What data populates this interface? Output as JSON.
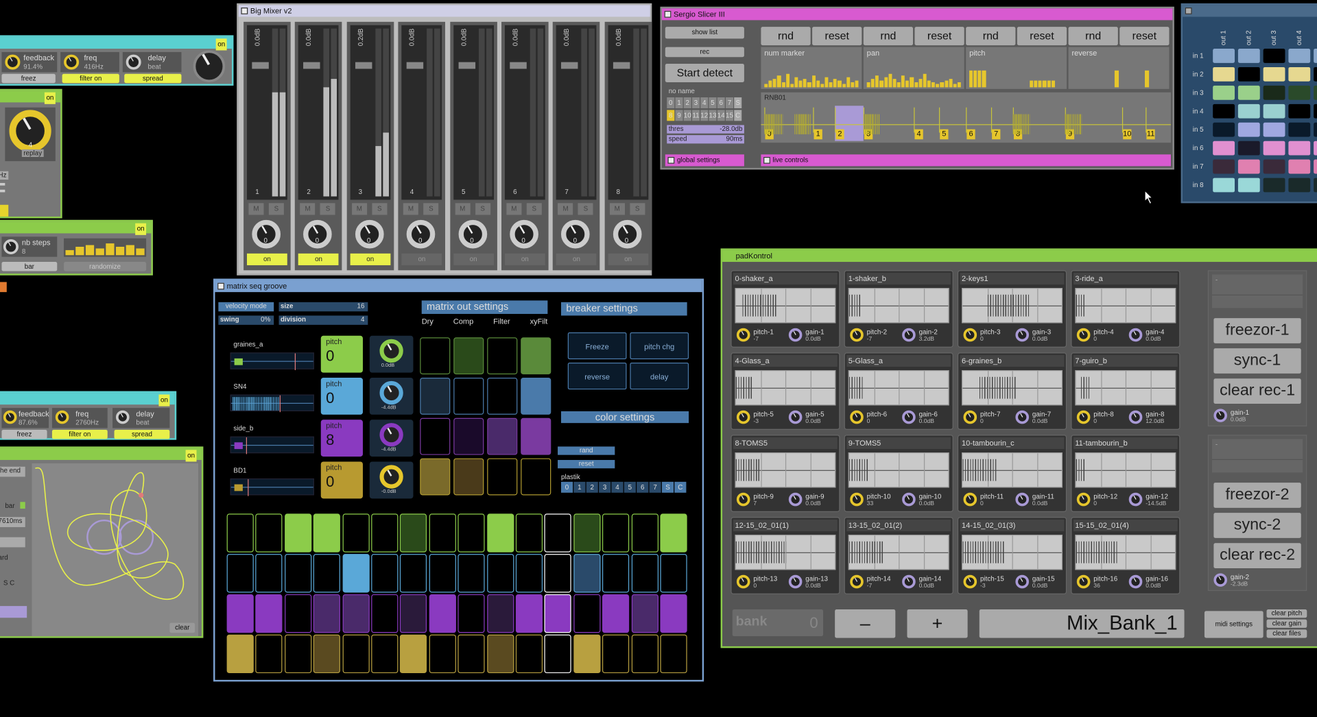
{
  "colors": {
    "bg": "#000000",
    "yellow": "#e8f04a",
    "green": "#8ccc4a",
    "pink": "#d85ad0",
    "purple": "#7a3aa0",
    "olive": "#b09a30",
    "blue": "#2a4a6a"
  },
  "delay1": {
    "on": "on",
    "feedback_label": "feedback",
    "feedback_value": "91.4%",
    "freq_label": "freq",
    "freq_value": "416Hz",
    "delay_label": "delay",
    "delay_value": "beat",
    "knob_value": "0",
    "freez": "freez",
    "filter": "filter on",
    "spread": "spread"
  },
  "replay": {
    "on": "on",
    "label": "replay",
    "value": "4",
    "hz": "Hz"
  },
  "steps": {
    "on": "on",
    "label": "nb steps",
    "value": "8",
    "bar": "bar",
    "randomize": "randomize"
  },
  "delay2": {
    "on": "on",
    "feedback_label": "feedback",
    "feedback_value": "87.6%",
    "freq_label": "freq",
    "freq_value": "2760Hz",
    "delay_label": "delay",
    "delay_value": "beat",
    "freez": "freez",
    "filter": "filter on",
    "spread": "spread"
  },
  "path": {
    "on": "on",
    "the_end": "he end",
    "bar": "bar",
    "ms": "7610ms",
    "ard": "ard",
    "sc": "S C",
    "clear": "clear"
  },
  "mixer": {
    "title": "Big Mixer v2",
    "channels": [
      {
        "db": "0.0dB",
        "num": "1",
        "val": "0",
        "on": "on"
      },
      {
        "db": "0.0dB",
        "num": "2",
        "val": "0",
        "on": "on"
      },
      {
        "db": "0.2dB",
        "num": "3",
        "val": "0",
        "on": "on"
      },
      {
        "db": "0.0dB",
        "num": "4",
        "val": "0",
        "on": "on"
      },
      {
        "db": "0.0dB",
        "num": "5",
        "val": "0",
        "on": "on"
      },
      {
        "db": "0.0dB",
        "num": "6",
        "val": "0",
        "on": "on"
      },
      {
        "db": "0.0dB",
        "num": "7",
        "val": "0",
        "on": "on"
      },
      {
        "db": "0.0dB",
        "num": "8",
        "val": "0",
        "on": "on"
      }
    ],
    "m": "M",
    "s": "S"
  },
  "slicer": {
    "title": "Sergio Slicer III",
    "show_list": "show list",
    "rec": "rec",
    "start_detect": "Start detect",
    "top_buttons": [
      "rnd",
      "reset",
      "rnd",
      "reset",
      "rnd",
      "reset",
      "rnd",
      "reset"
    ],
    "lanes": [
      "num marker",
      "pan",
      "pitch",
      "reverse"
    ],
    "no_name": "no name",
    "row1": [
      "0",
      "1",
      "2",
      "3",
      "4",
      "5",
      "6",
      "7",
      "S"
    ],
    "row2": [
      "8",
      "9",
      "10",
      "11",
      "12",
      "13",
      "14",
      "15",
      "C"
    ],
    "thres_label": "thres",
    "thres_value": "-28.0db",
    "speed_label": "speed",
    "speed_value": "90ms",
    "sample": "RNB01",
    "markers": [
      "0",
      "1",
      "2",
      "3",
      "4",
      "5",
      "6",
      "7",
      "8",
      "9",
      "10",
      "11"
    ],
    "global": "global settings",
    "live": "live controls"
  },
  "routing": {
    "cols": [
      "out 1",
      "out 2",
      "out 3",
      "out 4"
    ],
    "rows": [
      "in 1",
      "in 2",
      "in 3",
      "in 4",
      "in 5",
      "in 6",
      "in 7",
      "in 8"
    ]
  },
  "matrix": {
    "title": "matrix seq groove",
    "velocity_mode": "velocity mode",
    "size_label": "size",
    "size_value": "16",
    "swing_label": "swing",
    "swing_value": "0%",
    "division_label": "division",
    "division_value": "4",
    "tracks": [
      {
        "name": "graines_a",
        "pitch": "0",
        "db": "0.0dB"
      },
      {
        "name": "SN4",
        "pitch": "0",
        "db": "-4.4dB"
      },
      {
        "name": "side_b",
        "pitch": "8",
        "db": "-4.4dB"
      },
      {
        "name": "BD1",
        "pitch": "0",
        "db": "-0.0dB"
      }
    ],
    "pitch_label": "pitch",
    "out_settings": "matrix out settings",
    "out_tabs": [
      "Dry",
      "Comp",
      "Filter",
      "xyFilt"
    ],
    "breaker": "breaker settings",
    "breaker_buttons": [
      "Freeze",
      "pitch chg",
      "reverse",
      "delay"
    ],
    "color_settings": "color settings",
    "rand": "rand",
    "reset": "reset",
    "plastik": "plastik",
    "plastik_row": [
      "0",
      "1",
      "2",
      "3",
      "4",
      "5",
      "6",
      "7",
      "S",
      "C"
    ]
  },
  "pad": {
    "title": "padKontrol",
    "pads": [
      {
        "name": "0-shaker_a",
        "p": "pitch-1",
        "pv": "-7",
        "g": "gain-1",
        "gv": "0.0dB"
      },
      {
        "name": "1-shaker_b",
        "p": "pitch-2",
        "pv": "-7",
        "g": "gain-2",
        "gv": "3.2dB"
      },
      {
        "name": "2-keys1",
        "p": "pitch-3",
        "pv": "0",
        "g": "gain-3",
        "gv": "0.0dB"
      },
      {
        "name": "3-ride_a",
        "p": "pitch-4",
        "pv": "0",
        "g": "gain-4",
        "gv": "0.0dB"
      },
      {
        "name": "4-Glass_a",
        "p": "pitch-5",
        "pv": "-3",
        "g": "gain-5",
        "gv": "0.0dB"
      },
      {
        "name": "5-Glass_a",
        "p": "pitch-6",
        "pv": "0",
        "g": "gain-6",
        "gv": "0.0dB"
      },
      {
        "name": "6-graines_b",
        "p": "pitch-7",
        "pv": "0",
        "g": "gain-7",
        "gv": "0.0dB"
      },
      {
        "name": "7-guiro_b",
        "p": "pitch-8",
        "pv": "0",
        "g": "gain-8",
        "gv": "12.0dB"
      },
      {
        "name": "8-TOMS5",
        "p": "pitch-9",
        "pv": "7",
        "g": "gain-9",
        "gv": "0.0dB"
      },
      {
        "name": "9-TOMS5",
        "p": "pitch-10",
        "pv": "33",
        "g": "gain-10",
        "gv": "0.0dB"
      },
      {
        "name": "10-tambourin_c",
        "p": "pitch-11",
        "pv": "0",
        "g": "gain-11",
        "gv": "0.0dB"
      },
      {
        "name": "11-tambourin_b",
        "p": "pitch-12",
        "pv": "0",
        "g": "gain-12",
        "gv": "-14.5dB"
      },
      {
        "name": "12-15_02_01(1)",
        "p": "pitch-13",
        "pv": "0",
        "g": "gain-13",
        "gv": "0.0dB"
      },
      {
        "name": "13-15_02_01(2)",
        "p": "pitch-14",
        "pv": "-7",
        "g": "gain-14",
        "gv": "0.0dB"
      },
      {
        "name": "14-15_02_01(3)",
        "p": "pitch-15",
        "pv": "-3",
        "g": "gain-15",
        "gv": "0.0dB"
      },
      {
        "name": "15-15_02_01(4)",
        "p": "pitch-16",
        "pv": "36",
        "g": "gain-16",
        "gv": "0.0dB"
      }
    ],
    "side1": {
      "dash": "-",
      "freezor": "freezor-1",
      "sync": "sync-1",
      "clear": "clear rec-1",
      "gain": "gain-1",
      "gain_v": "0.0dB"
    },
    "side2": {
      "dash": "-",
      "freezor": "freezor-2",
      "sync": "sync-2",
      "clear": "clear rec-2",
      "gain": "gain-2",
      "gain_v": "-2.3dB"
    },
    "bank_label": "bank",
    "bank_value": "0",
    "minus": "–",
    "plus": "+",
    "bank_name": "Mix_Bank_1",
    "midi": "midi settings",
    "clear_pitch": "clear pitch",
    "clear_gain": "clear gain",
    "clear_files": "clear files"
  }
}
